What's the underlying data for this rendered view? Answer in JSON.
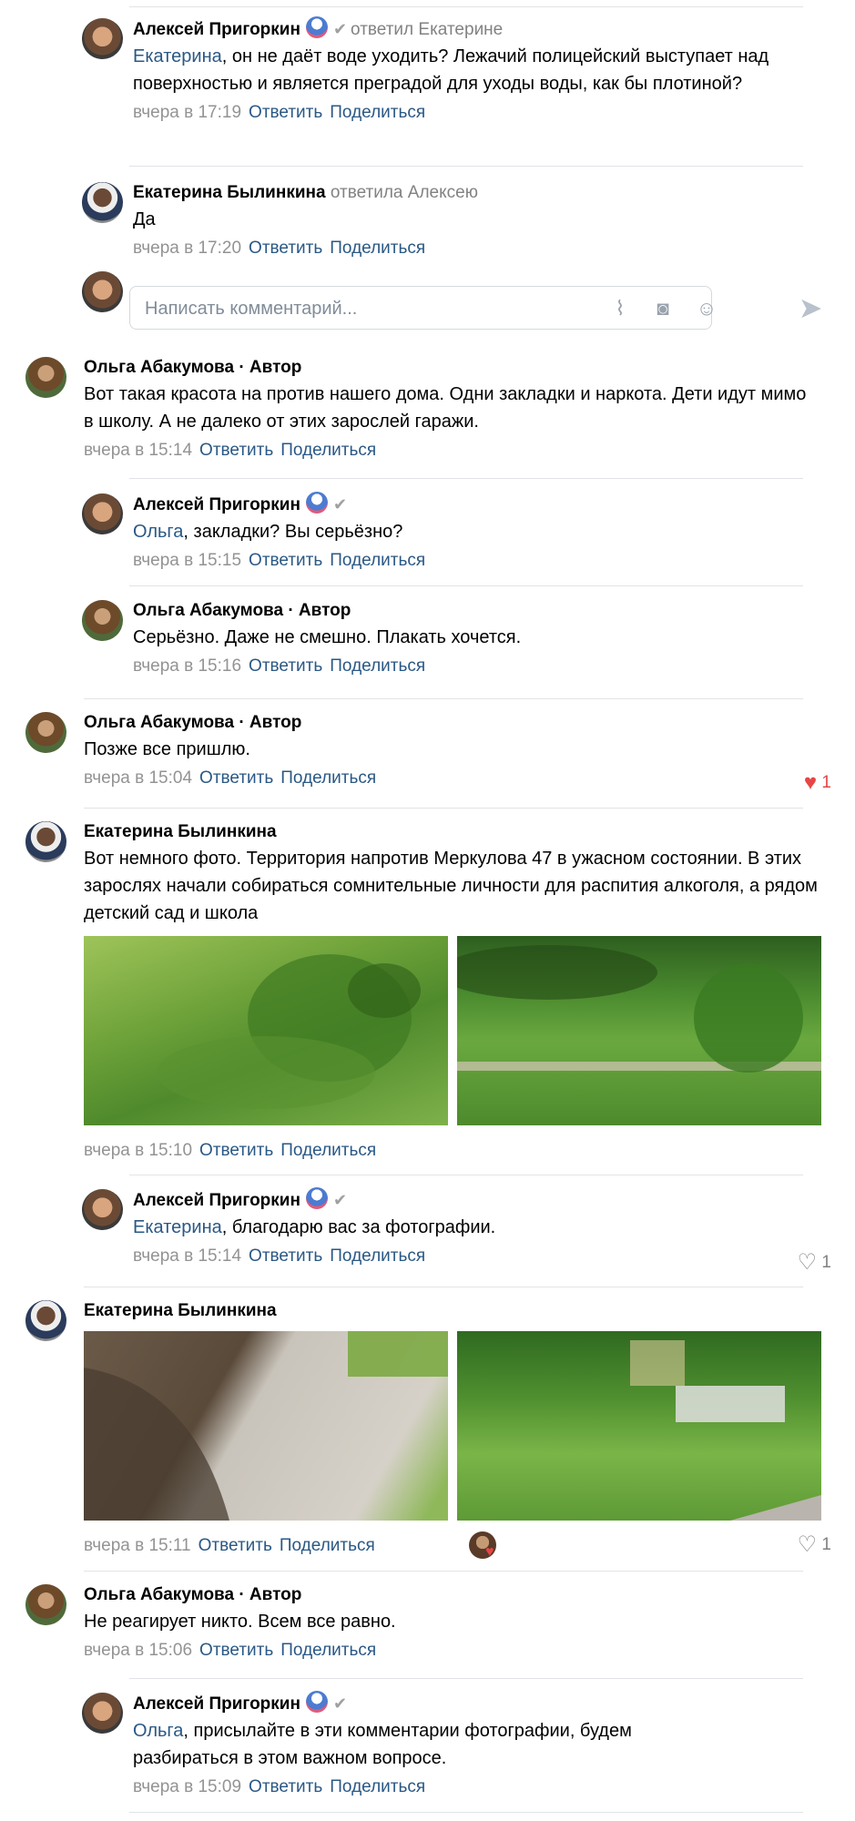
{
  "comments": [
    {
      "name": "Алексей Пригоркин",
      "replied": "ответил Екатерине",
      "mention": "Екатерина",
      "text": ", он не даёт воде уходить? Лежачий полицейский выступает над поверхностью и является преградой для уходы воды, как бы плотиной?",
      "time": "вчера в 17:19"
    },
    {
      "name": "Екатерина Былинкина",
      "replied": "ответила Алексею",
      "text": "Да",
      "time": "вчера в 17:20"
    },
    {
      "name": "Ольга Абакумова · Автор",
      "text": "Вот такая красота на против нашего дома. Одни закладки и наркота. Дети идут мимо в школу. А не далеко от этих зарослей гаражи.",
      "time": "вчера в 15:14"
    },
    {
      "name": "Алексей Пригоркин",
      "mention": "Ольга",
      "text": ", закладки? Вы серьёзно?",
      "time": "вчера в 15:15"
    },
    {
      "name": "Ольга Абакумова · Автор",
      "text": "Серьёзно. Даже не смешно. Плакать хочется.",
      "time": "вчера в 15:16"
    },
    {
      "name": "Ольга Абакумова · Автор",
      "text": "Позже все пришлю.",
      "time": "вчера в 15:04",
      "likes": "1"
    },
    {
      "name": "Екатерина Былинкина",
      "text": "Вот немного фото. Территория напротив Меркулова 47 в ужасном состоянии. В этих зарослях начали собираться сомнительные личности для распития алкоголя, а рядом детский сад и школа",
      "time": "вчера в 15:10"
    },
    {
      "name": "Алексей Пригоркин",
      "mention": "Екатерина",
      "text": ", благодарю вас за фотографии.",
      "time": "вчера в 15:14",
      "likes": "1"
    },
    {
      "name": "Екатерина Былинкина",
      "time": "вчера в 15:11",
      "likes": "1"
    },
    {
      "name": "Ольга Абакумова · Автор",
      "text": "Не реагирует никто. Всем все равно.",
      "time": "вчера в 15:06"
    },
    {
      "name": "Алексей Пригоркин",
      "mention": "Ольга",
      "text": ", присылайте в эти комментарии фотографии, будем разбираться в этом важном вопросе.",
      "time": "вчера в 15:09"
    }
  ],
  "actions": {
    "reply": "Ответить",
    "share": "Поделиться"
  },
  "composer": {
    "placeholder": "Написать комментарий..."
  },
  "icons": {
    "verified": "checkmark-icon",
    "attach": "paperclip-icon",
    "camera": "camera-icon",
    "emoji": "smile-icon",
    "send": "send-icon",
    "like": "heart-icon"
  },
  "colors": {
    "link": "#2a5885",
    "meta": "#939393",
    "like_active": "#e64646",
    "separator": "#e1e3e6"
  }
}
